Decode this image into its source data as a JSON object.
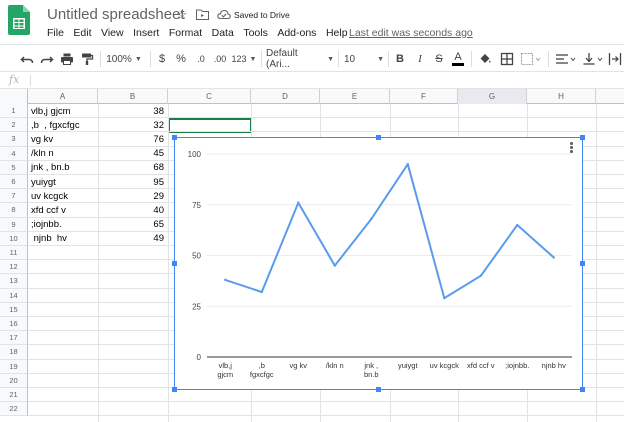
{
  "app": {
    "title": "Untitled spreadsheet",
    "saved_status": "Saved to Drive",
    "last_edit": "Last edit was seconds ago"
  },
  "menu": [
    "File",
    "Edit",
    "View",
    "Insert",
    "Format",
    "Data",
    "Tools",
    "Add-ons",
    "Help"
  ],
  "toolbar": {
    "zoom": "100%",
    "currency": "$",
    "percent": "%",
    "decrease_decimal": ".0",
    "increase_decimal": ".00",
    "more_formats": "123",
    "font": "Default (Ari...",
    "font_size": "10",
    "bold": "B",
    "italic": "I",
    "strike": "S",
    "text_color": "A"
  },
  "formula_bar": {
    "fx": "fx",
    "value": ""
  },
  "columns": [
    "A",
    "B",
    "C",
    "D",
    "E",
    "F",
    "G",
    "H"
  ],
  "rows": [
    "1",
    "2",
    "3",
    "4",
    "5",
    "6",
    "7",
    "8",
    "9",
    "10",
    "11",
    "12",
    "13",
    "14",
    "15",
    "16",
    "17",
    "18",
    "19",
    "20",
    "21",
    "22"
  ],
  "cells": [
    {
      "a": "vlb,j gjcm",
      "b": "38"
    },
    {
      "a": ",b  , fgxcfgc",
      "b": "32"
    },
    {
      "a": "vg kv",
      "b": "76"
    },
    {
      "a": "/kln n",
      "b": "45"
    },
    {
      "a": "jnk , bn.b",
      "b": "68"
    },
    {
      "a": "yuiygt",
      "b": "95"
    },
    {
      "a": "uv kcgck",
      "b": "29"
    },
    {
      "a": "xfd ccf v",
      "b": "40"
    },
    {
      "a": ";iojnbb.",
      "b": "65"
    },
    {
      "a": " njnb  hv",
      "b": "49"
    }
  ],
  "colors": {
    "accent": "#4285f4",
    "line": "#5b9bec",
    "selection": "#1a7f46",
    "logo_green": "#23a566"
  },
  "chart_data": {
    "type": "line",
    "categories": [
      "vlb,j gjcm",
      ",b , fgxcfgc",
      "vg kv",
      "/kln n",
      "jnk , bn.b",
      "yuiygt",
      "uv kcgck",
      "xfd ccf v",
      ";iojnbb.",
      "njnb hv"
    ],
    "category_labels": [
      [
        "vlb,j",
        "gjcm"
      ],
      [
        ",b",
        "fgxcfgc"
      ],
      [
        "vg kv"
      ],
      [
        "/kln n"
      ],
      [
        "jnk ,",
        "bn.b"
      ],
      [
        "yuiygt"
      ],
      [
        "uv kcgck"
      ],
      [
        "xfd ccf v"
      ],
      [
        ";iojnbb."
      ],
      [
        "njnb  hv"
      ]
    ],
    "values": [
      38,
      32,
      76,
      45,
      68,
      95,
      29,
      40,
      65,
      49
    ],
    "yticks": [
      0,
      25,
      50,
      75,
      100
    ],
    "ylim": [
      0,
      100
    ],
    "grid": true,
    "title": "",
    "xlabel": "",
    "ylabel": ""
  }
}
